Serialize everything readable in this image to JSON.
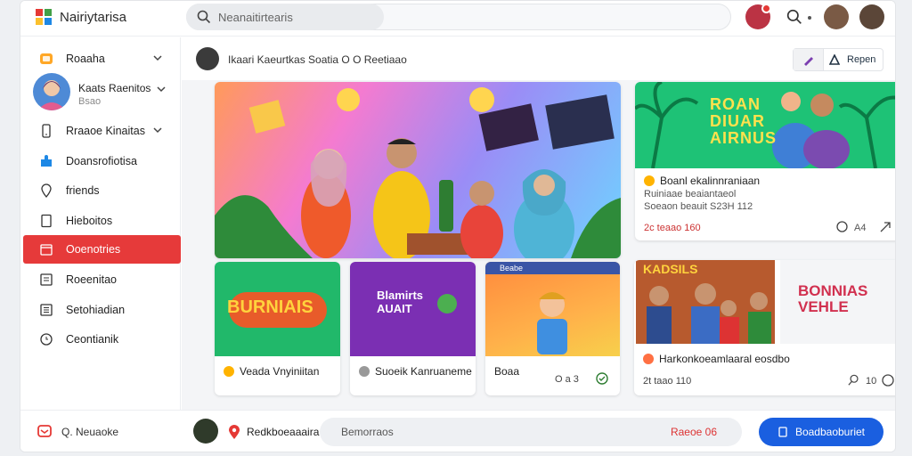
{
  "app": {
    "title": "Nairiytarisa"
  },
  "search": {
    "placeholder": "Neanaitirtearis"
  },
  "sidebar": {
    "items": [
      {
        "label": "Roaaha"
      },
      {
        "label": "Rraaoe Kinaitas"
      },
      {
        "label": "Doansrofiotisa"
      },
      {
        "label": "friends"
      },
      {
        "label": "Hieboitos"
      },
      {
        "label": "Ooenotries"
      },
      {
        "label": "Roeenitao"
      },
      {
        "label": "Setohiadian"
      },
      {
        "label": "Ceontianik"
      }
    ],
    "profile": {
      "name": "Kaats Raenitos",
      "sub": "Bsao"
    }
  },
  "main": {
    "post_head": {
      "text": "Ikaari Kaeurtkas  Soatia O  O  Reetiaao"
    },
    "view_button": "Repen",
    "banner_card": {
      "banner_text": "ROAN\nDIUAR\nAIRNUS",
      "title": "Boanl ekalinnraniaan",
      "sub1": "Ruiniaae beaiantaeol",
      "sub2": "Soeaon beauit S23H 112",
      "meta_left": "2c  teaao 160",
      "meta_right": "A4"
    },
    "tiles": [
      {
        "caption": "Veada Vnyiniitan",
        "image_text": "BURNIAIS"
      },
      {
        "caption": "Suoeik Kanruaneme",
        "image_text": "Blamirts\nAUAIT"
      },
      {
        "caption": "Boaa",
        "top_label": "Beabe",
        "meta": "O  a 3"
      },
      {
        "caption": "Harkonkoeamlaaral eosdbo",
        "meta": "2t  taao 110",
        "meta_right": "10"
      },
      {
        "image_text": "BONNIAS\nVEHLE"
      }
    ]
  },
  "bottombar": {
    "label": "Q.  Neuaoke",
    "name": "Redkboeaaaira",
    "input_placeholder": "Bemorraos",
    "input_right": "Raeoe 06",
    "send_label": "Boadbaoburiet"
  },
  "colors": {
    "accent": "#e63a3a",
    "primary": "#1a5fe0",
    "green": "#1ec276"
  }
}
